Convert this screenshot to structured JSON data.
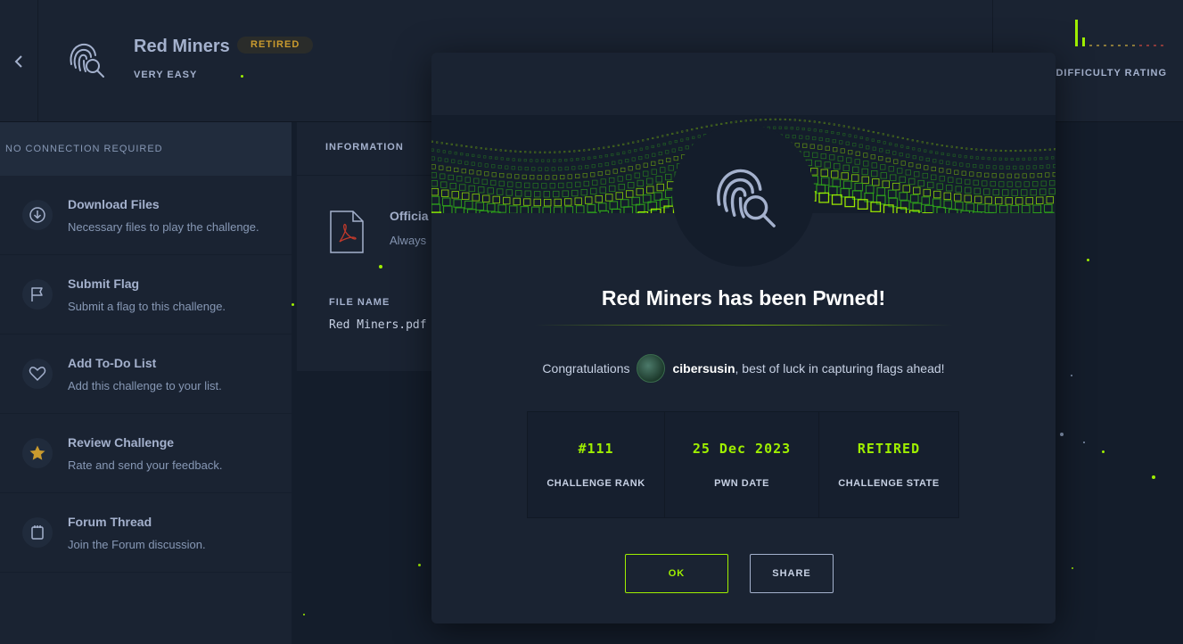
{
  "header": {
    "title": "Red Miners",
    "badge": "RETIRED",
    "difficulty": "VERY EASY",
    "difficulty_rating_label": "DIFFICULTY RATING",
    "difficulty_level": 1
  },
  "sidebar": {
    "connection": "NO CONNECTION REQUIRED",
    "items": [
      {
        "title": "Download Files",
        "subtitle": "Necessary files to play the challenge.",
        "icon": "download-icon"
      },
      {
        "title": "Submit Flag",
        "subtitle": "Submit a flag to this challenge.",
        "icon": "flag-icon"
      },
      {
        "title": "Add To-Do List",
        "subtitle": "Add this challenge to your list.",
        "icon": "heart-icon"
      },
      {
        "title": "Review Challenge",
        "subtitle": "Rate and send your feedback.",
        "icon": "star-icon"
      },
      {
        "title": "Forum Thread",
        "subtitle": "Join the Forum discussion.",
        "icon": "forum-icon"
      }
    ]
  },
  "main": {
    "tab": "INFORMATION",
    "official_title": "Officia",
    "official_sub": "Always",
    "file_label": "FILE NAME",
    "file_name": "Red Miners.pdf"
  },
  "modal": {
    "title": "Red Miners has been Pwned!",
    "congrats_prefix": "Congratulations",
    "username": "cibersusin",
    "congrats_suffix": ", best of luck in capturing flags ahead!",
    "stats": [
      {
        "value": "#111",
        "label": "CHALLENGE RANK"
      },
      {
        "value": "25 Dec 2023",
        "label": "PWN DATE"
      },
      {
        "value": "RETIRED",
        "label": "CHALLENGE STATE"
      }
    ],
    "ok_label": "OK",
    "share_label": "SHARE"
  },
  "colors": {
    "accent": "#9fef00",
    "badge": "#c99a2e",
    "background": "#141d2b",
    "panel": "#1a2332"
  }
}
